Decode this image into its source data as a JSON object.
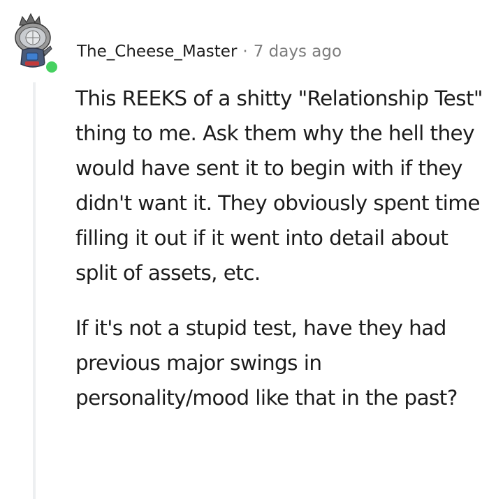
{
  "comment": {
    "username": "The_Cheese_Master",
    "separator": "·",
    "timestamp": "7 days ago",
    "avatar_icon": "snoo-avatar-icon",
    "online_indicator_color": "#46d160",
    "paragraphs": [
      "This REEKS of a shitty \"Relationship Test\" thing to me. Ask them why the hell they would have sent it to begin with if they didn't want it. They obviously spent time filling it out if it went into detail about split of assets, etc.",
      "If it's not a stupid test, have they had previous major swings in personality/mood like that in the past?"
    ]
  }
}
